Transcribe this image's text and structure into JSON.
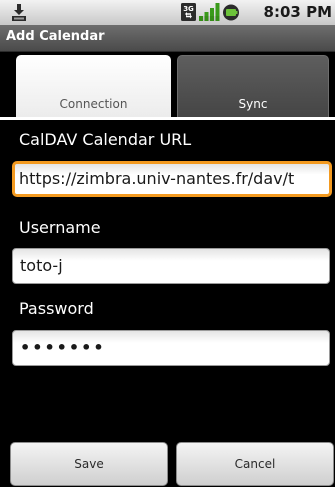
{
  "status_bar": {
    "time": "8:03 PM",
    "icons": [
      "download-icon",
      "3g-network-icon",
      "signal-strength-icon",
      "battery-icon"
    ],
    "network_badge": "3G"
  },
  "title_bar": {
    "title": "Add Calendar"
  },
  "tabs": [
    {
      "label": "Connection",
      "selected": true
    },
    {
      "label": "Sync",
      "selected": false
    }
  ],
  "form": {
    "url": {
      "label": "CalDAV Calendar URL",
      "value": "https://zimbra.univ-nantes.fr/dav/t"
    },
    "username": {
      "label": "Username",
      "value": "toto-j"
    },
    "password": {
      "label": "Password",
      "value": "•••••••"
    }
  },
  "buttons": {
    "save": "Save",
    "cancel": "Cancel"
  },
  "colors": {
    "focus_border": "#f39a20",
    "background": "#000000",
    "status_bar": "#dcdcdc"
  }
}
